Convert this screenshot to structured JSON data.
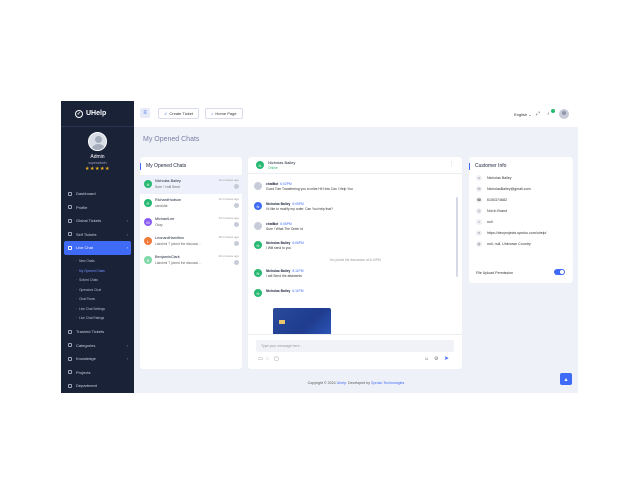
{
  "brand": {
    "name": "UHelp"
  },
  "profile": {
    "name": "Admin",
    "role": "superadmin",
    "stars": "★★★★★"
  },
  "nav": [
    {
      "label": "Dashboard",
      "chevron": ""
    },
    {
      "label": "Profile",
      "chevron": ""
    },
    {
      "label": "Global Tickets",
      "chevron": "›"
    },
    {
      "label": "Self Tickets",
      "chevron": "›"
    },
    {
      "label": "Live Chat",
      "chevron": "›",
      "active": true
    },
    {
      "label": "Trashed Tickets",
      "chevron": ""
    },
    {
      "label": "Categories",
      "chevron": "›"
    },
    {
      "label": "Knowledge",
      "chevron": "›"
    },
    {
      "label": "Projects",
      "chevron": ""
    },
    {
      "label": "Department",
      "chevron": ""
    }
  ],
  "live_chat_sub": [
    {
      "label": "New Chats"
    },
    {
      "label": "My Opened Chats",
      "active": true
    },
    {
      "label": "Solved Chats"
    },
    {
      "label": "Operators Chat"
    },
    {
      "label": "Chat Flows"
    },
    {
      "label": "Live Chat Settings"
    },
    {
      "label": "Live Chat Ratings"
    }
  ],
  "topbar": {
    "menu_icon": "≡",
    "create_ticket": "Create Ticket",
    "home_page": "Home Page",
    "language": "English ⌄"
  },
  "page_title": "My Opened Chats",
  "chat_list": {
    "title": "My Opened Chats",
    "items": [
      {
        "initial": "N",
        "name": "Nicholas Bailey",
        "preview": "Sure ! I will Send",
        "time": "11 minutes ago",
        "color": "#27b872"
      },
      {
        "initial": "R",
        "name": "RichardHudson",
        "preview": "candidat",
        "time": "12 minutes ago",
        "color": "#27b872"
      },
      {
        "initial": "M",
        "name": "MichaelLee",
        "preview": "Okay",
        "time": "13 minutes ago",
        "color": "#8a5cf6"
      },
      {
        "initial": "L",
        "name": "LeonardHamilton",
        "preview": "Lakshmi T joined the discussi...",
        "time": "18 minutes ago",
        "color": "#f07a3a"
      },
      {
        "initial": "B",
        "name": "BenjaminClark",
        "preview": "Lakshmi T joined the discussi...",
        "time": "20 minutes ago",
        "color": "#7fd8a6"
      }
    ]
  },
  "conversation": {
    "contact_name": "Nicholas Bailey",
    "contact_status": "Online",
    "system_note": "You joined the discussion at 6:10PM",
    "messages": [
      {
        "initial": "",
        "sender": "chatBot",
        "time": "6:02PM",
        "text": "Good Tom Transferring you to mike Hi! How Can I Help You",
        "color": "#c7ccd8"
      },
      {
        "initial": "N",
        "sender": "Nicholas Bailey",
        "time": "6:05PM",
        "text": "I'd like to modify my order. Can You help that?",
        "color": "#3f6af6"
      },
      {
        "initial": "",
        "sender": "chatBot",
        "time": "6:06PM",
        "text": "Sure ! What The Order Id",
        "color": "#c7ccd8"
      },
      {
        "initial": "N",
        "sender": "Nicholas Bailey",
        "time": "6:06PM",
        "text": "I Will send to you",
        "color": "#27b872"
      },
      {
        "initial": "N",
        "sender": "Nicholas Bailey",
        "time": "6:11PM",
        "text": "I will Send the attaments",
        "color": "#27b872"
      },
      {
        "initial": "N",
        "sender": "Nicholas Bailey",
        "time": "6:11PM",
        "text": "",
        "color": "#27b872"
      }
    ],
    "input_placeholder": "Type your message here..."
  },
  "customer_info": {
    "title": "Customer Info",
    "rows": [
      {
        "icon": "user-icon",
        "glyph": "☺",
        "value": "Nicholas Bailey"
      },
      {
        "icon": "mail-icon",
        "glyph": "✉",
        "value": "NicholasBailey@gmail.com"
      },
      {
        "icon": "phone-icon",
        "glyph": "☎",
        "value": "6150374682"
      },
      {
        "icon": "browser-icon",
        "glyph": "◎",
        "value": "Not in Brand"
      },
      {
        "icon": "location-icon",
        "glyph": "⌂",
        "value": "null"
      },
      {
        "icon": "link-icon",
        "glyph": "∞",
        "value": "https://devprojects.spruko.com/uhelp/"
      },
      {
        "icon": "globe-icon",
        "glyph": "◍",
        "value": "null, null, Unknown Country"
      }
    ],
    "file_upload_label": "File Upload Permission",
    "file_upload_enabled": true
  },
  "footer": {
    "prefix": "Copyright © 2024",
    "brand": "Uhelp",
    "middle": ". Developed by",
    "dev": "Spruko Technologies"
  },
  "colors": {
    "primary": "#3f6af6",
    "sidebar": "#1a2238",
    "success": "#27b872",
    "background": "#eff1f8"
  }
}
